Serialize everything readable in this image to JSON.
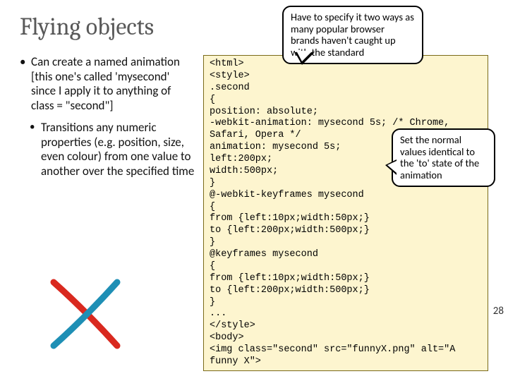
{
  "title": "Flying objects",
  "bullets": {
    "b1": "Can create a named animation [this one's called 'mysecond' since I apply it to anything of class = \"second\"]",
    "b2": "Transitions any numeric properties (e.g. position, size, even colour) from one value to another over the specified time"
  },
  "code": "<html>\n<style>\n.second\n{\nposition: absolute;\n-webkit-animation: mysecond 5s; /* Chrome, Safari, Opera */\nanimation: mysecond 5s;\nleft:200px;\nwidth:500px;\n}\n@-webkit-keyframes mysecond\n{\nfrom {left:10px;width:50px;}\nto {left:200px;width:500px;}\n}\n@keyframes mysecond\n{\nfrom {left:10px;width:50px;}\nto {left:200px;width:500px;}\n}\n...\n</style>\n<body>\n<img class=\"second\" src=\"funnyX.png\" alt=\"A funny X\">",
  "callouts": {
    "top": "Have to specify it two ways as many popular browser brands haven't caught up with the standard",
    "right": "Set the normal values identical to the 'to' state of the animation"
  },
  "page_number": "28",
  "graphic": {
    "name": "funnyX-illustration",
    "colors": {
      "red": "#d9291f",
      "blue": "#1e8fb5"
    }
  }
}
